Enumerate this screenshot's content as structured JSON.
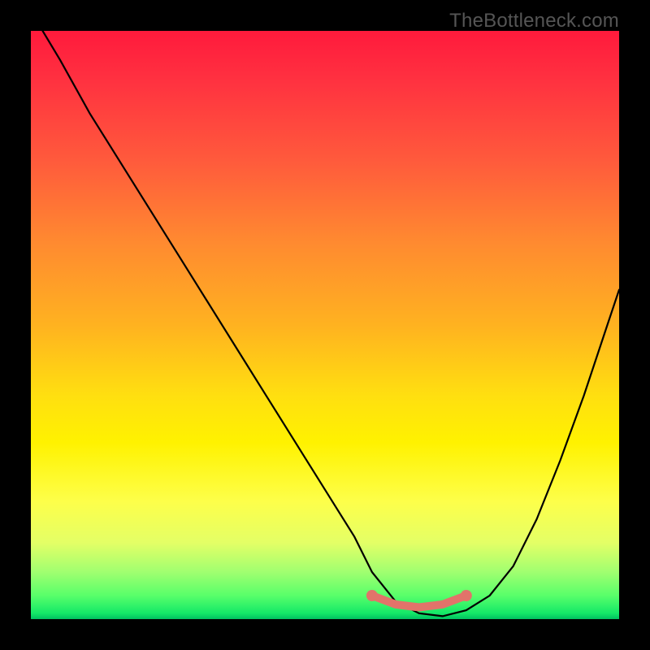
{
  "watermark": "TheBottleneck.com",
  "chart_data": {
    "type": "line",
    "title": "",
    "xlabel": "",
    "ylabel": "",
    "xlim": [
      0,
      100
    ],
    "ylim": [
      0,
      100
    ],
    "series": [
      {
        "name": "curve",
        "x": [
          2,
          5,
          10,
          15,
          20,
          25,
          30,
          35,
          40,
          45,
          50,
          55,
          58,
          62,
          66,
          70,
          74,
          78,
          82,
          86,
          90,
          94,
          98,
          100
        ],
        "values": [
          100,
          95,
          86,
          78,
          70,
          62,
          54,
          46,
          38,
          30,
          22,
          14,
          8,
          3,
          1,
          0.5,
          1.5,
          4,
          9,
          17,
          27,
          38,
          50,
          56
        ]
      }
    ],
    "highlight": {
      "name": "flat-region",
      "x": [
        58,
        62,
        66,
        70,
        74
      ],
      "values": [
        4,
        2.5,
        2,
        2.5,
        4
      ]
    },
    "background_gradient": {
      "top": "#ff1a3c",
      "bottom": "#00c060"
    }
  }
}
